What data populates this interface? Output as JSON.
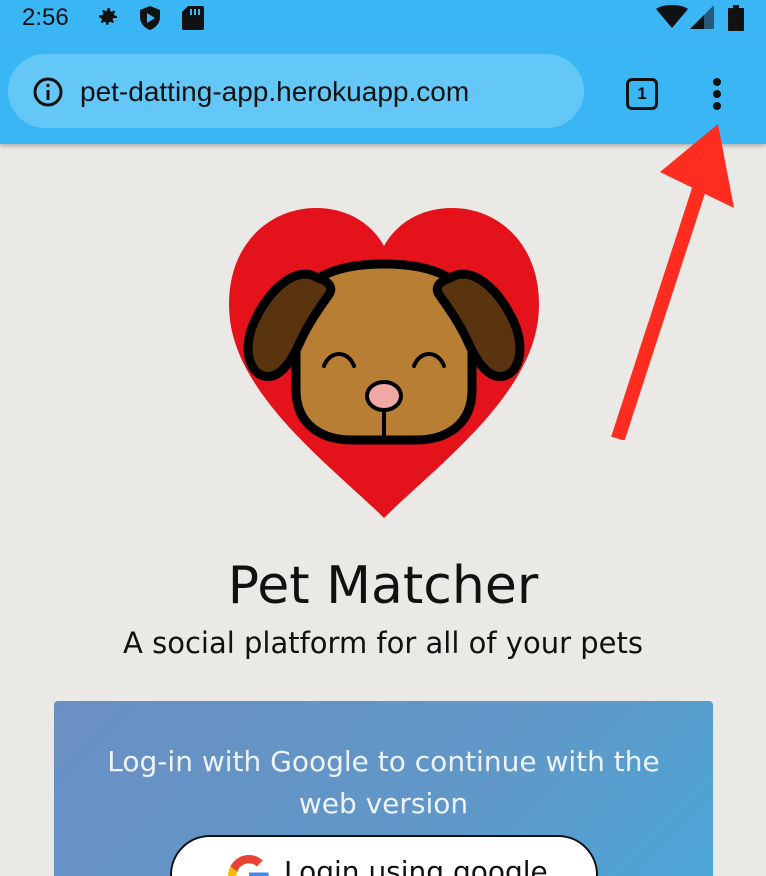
{
  "status_bar": {
    "time": "2:56",
    "icons": [
      "gear-icon",
      "shield-play-icon",
      "sd-card-icon",
      "wifi-icon",
      "signal-icon",
      "battery-icon"
    ]
  },
  "browser": {
    "url": "pet-datting-app.herokuapp.com",
    "tab_count": "1",
    "toolbar_color": "#3bb6f5",
    "url_bar_color": "#63c7f8"
  },
  "page": {
    "title": "Pet Matcher",
    "subtitle": "A social platform for all of your pets",
    "logo": "heart-dog-logo",
    "logo_colors": {
      "heart": "#e3121b",
      "dog": "#b87e33",
      "ears": "#5a340e"
    },
    "login_card": {
      "message": "Log-in with Google to continue with the web version",
      "button_label": "Login using google"
    }
  },
  "annotation": {
    "arrow_color": "#ff2d20",
    "target": "menu-dots-icon"
  }
}
